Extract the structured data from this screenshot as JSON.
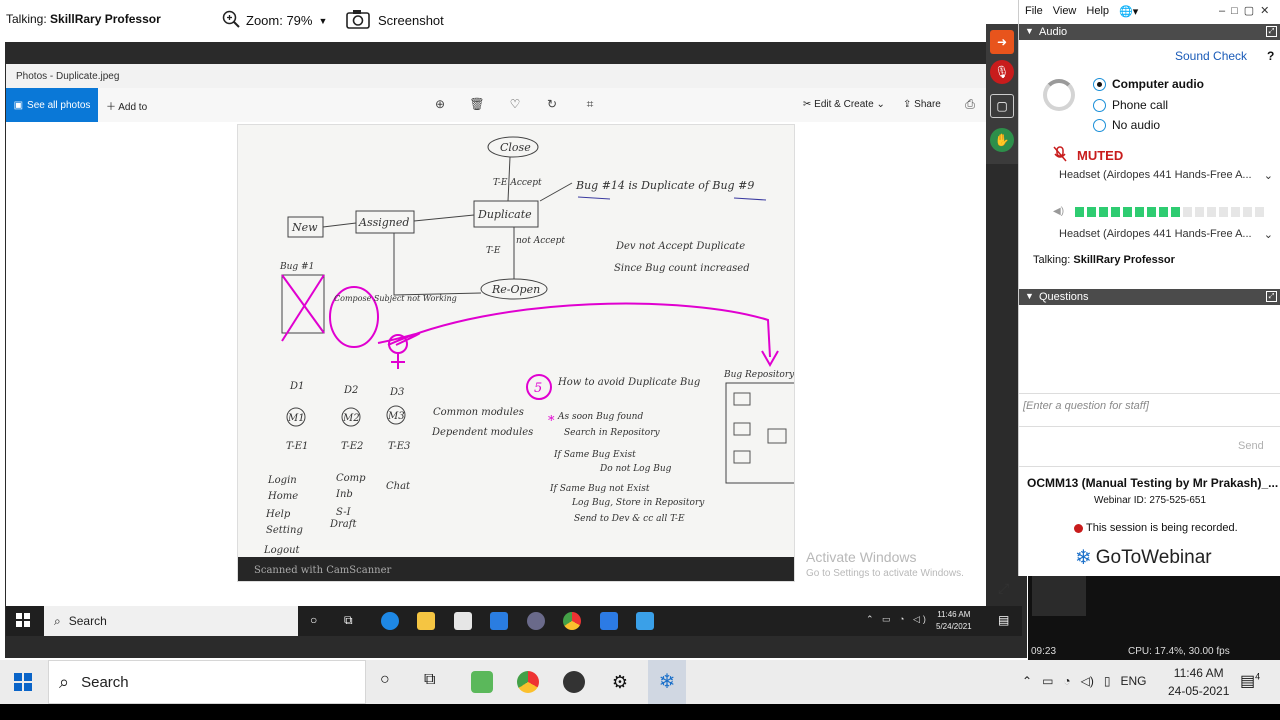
{
  "topbar": {
    "talking_label": "Talking:",
    "talking_name": "SkillRary Professor",
    "zoom_label": "Zoom: 79%",
    "screenshot_label": "Screenshot"
  },
  "photos": {
    "window_title": "Photos - Duplicate.jpeg",
    "see_all": "See all photos",
    "add_to": "Add to",
    "edit_create": "Edit & Create",
    "share": "Share"
  },
  "document": {
    "nodes": [
      "Close",
      "New",
      "Assigned",
      "Duplicate",
      "Re-Open"
    ],
    "labels": [
      "T-E Accept",
      "T-E",
      "not Accept",
      "Bug #14 is Duplicate of Bug #9",
      "Dev not Accept Duplicate",
      "Since Bug count increased",
      "Bug #1",
      "Compose Subject not Working"
    ],
    "col_d": [
      "D1",
      "D2",
      "D3"
    ],
    "col_m": [
      "M1",
      "M2",
      "M3"
    ],
    "col_te": [
      "T-E1",
      "T-E2",
      "T-E3"
    ],
    "common": [
      "Common modules",
      "Dependent modules"
    ],
    "avoid_title": "How to avoid Duplicate Bug",
    "avoid_num": "5",
    "avoid_lines": [
      "As soon Bug found",
      "Search in Repository",
      "If Same Bug Exist",
      "Do not Log Bug",
      "If Same Bug not Exist",
      "Log Bug, Store in Repository",
      "Send to Dev & cc all T-E"
    ],
    "repo_label": "Bug Repository",
    "modules1": [
      "Login",
      "Home",
      "Help",
      "Setting",
      "Logout"
    ],
    "modules2": [
      "Comp",
      "Inb",
      "S-I",
      "Draft"
    ],
    "modules3": [
      "Chat"
    ],
    "scanner": "Scanned with CamScanner"
  },
  "watermark": {
    "line1": "Activate Windows",
    "line2": "Go to Settings to activate Windows."
  },
  "inner_taskbar": {
    "search": "Search",
    "time": "11:46 AM",
    "date": "5/24/2021"
  },
  "panel": {
    "menu": [
      "File",
      "View",
      "Help"
    ],
    "audio_header": "Audio",
    "sound_check": "Sound Check",
    "help_mark": "?",
    "options": [
      {
        "label": "Computer audio",
        "selected": true
      },
      {
        "label": "Phone call",
        "selected": false
      },
      {
        "label": "No audio",
        "selected": false
      }
    ],
    "muted": "MUTED",
    "device1": "Headset (Airdopes 441 Hands-Free A...",
    "device2": "Headset (Airdopes 441 Hands-Free A...",
    "meter_level": 0.55,
    "talking_label": "Talking:",
    "talking_name": "SkillRary Professor",
    "questions_header": "Questions",
    "question_placeholder": "[Enter a question for staff]",
    "send": "Send",
    "webinar_title": "OCMM13 (Manual Testing by Mr Prakash)_...",
    "webinar_id": "Webinar ID: 275-525-651",
    "recording": "This session is being recorded.",
    "logo": "GoToWebinar"
  },
  "stats": {
    "time": "09:23",
    "cpu": "CPU: 17.4%, 30.00 fps"
  },
  "taskbar": {
    "search": "Search",
    "lang": "ENG",
    "time": "11:46 AM",
    "date": "24-05-2021",
    "notif_count": "4"
  },
  "colors": {
    "accent": "#0a78d7",
    "muted_red": "#c81c1c",
    "meter_green": "#2ecc71",
    "ink": "#333333",
    "magenta": "#e000d0"
  }
}
